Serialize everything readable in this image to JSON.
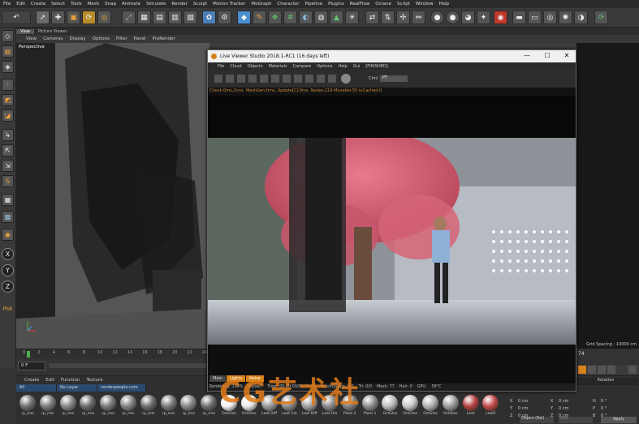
{
  "menubar": [
    "File",
    "Edit",
    "Create",
    "Select",
    "Tools",
    "Mesh",
    "Snap",
    "Animate",
    "Simulate",
    "Render",
    "Sculpt",
    "Motion Tracker",
    "MoGraph",
    "Character",
    "Pipeline",
    "Plugins",
    "RealFlow",
    "Octane",
    "Script",
    "Window",
    "Help"
  ],
  "tabs": [
    "View",
    "Picture Viewer"
  ],
  "viewport_menu": [
    "View",
    "Cameras",
    "Display",
    "Options",
    "Filter",
    "Panel",
    "ProRender"
  ],
  "viewport": {
    "label": "Perspective",
    "grid_spacing": "Grid Spacing : 10000 cm"
  },
  "timeline_ticks": [
    "0",
    "2",
    "4",
    "6",
    "8",
    "10",
    "12",
    "14",
    "16",
    "18",
    "20",
    "22",
    "24"
  ],
  "frame_field": "0 F",
  "frame_end": "74",
  "material_menu": [
    "Create",
    "Edit",
    "Function",
    "Texture"
  ],
  "material_filter": [
    "All",
    "No Layer",
    "renderpeople.com"
  ],
  "materials": [
    {
      "label": "rp_mei",
      "color": "#6e6e6e"
    },
    {
      "label": "rp_mei",
      "color": "#7a7a7a"
    },
    {
      "label": "rp_mei",
      "color": "#858585"
    },
    {
      "label": "rp_mei",
      "color": "#6a6a6a"
    },
    {
      "label": "rp_mei",
      "color": "#777"
    },
    {
      "label": "rp_mei",
      "color": "#808080"
    },
    {
      "label": "rp_mei",
      "color": "#6c6c6c"
    },
    {
      "label": "rp_mei",
      "color": "#787878"
    },
    {
      "label": "rp_mei",
      "color": "#858585"
    },
    {
      "label": "rp_mei",
      "color": "#6d6d6d"
    },
    {
      "label": "OctGlos",
      "color": "#f2f2f2"
    },
    {
      "label": "OctGlos",
      "color": "#e8e8e8"
    },
    {
      "label": "Leaf Diff",
      "color": "#9a9a9a"
    },
    {
      "label": "Leaf Glo",
      "color": "#8a8a8a"
    },
    {
      "label": "Leaf Diff",
      "color": "#a0a0a0"
    },
    {
      "label": "Leaf Glo",
      "color": "#888"
    },
    {
      "label": "Plant 2",
      "color": "#7c7c7c"
    },
    {
      "label": "Plant 1",
      "color": "#8c8c8c"
    },
    {
      "label": "OctGlas",
      "color": "#bcbcbc"
    },
    {
      "label": "OctGlos",
      "color": "#c8c8c8"
    },
    {
      "label": "OctGlos",
      "color": "#b0b0b0"
    },
    {
      "label": "OctGlos",
      "color": "#9c9c9c"
    },
    {
      "label": "Leaf",
      "color": "#b44040"
    },
    {
      "label": "Leaf2",
      "color": "#c24848"
    }
  ],
  "coords": {
    "x": "0 cm",
    "y": "0 cm",
    "z": "0 cm",
    "x2": "0 cm",
    "y2": "0 cm",
    "z2": "0 cm",
    "h": "0 °",
    "p": "0 °",
    "b": "0 °",
    "mode": "Object (Rel)",
    "size": "Size",
    "apply": "Apply",
    "rotation": "Rotation"
  },
  "live_viewer": {
    "title": "Live Viewer Studio 2018.1-RC1 (16 days left)",
    "menu": [
      "File",
      "Cloud",
      "Objects",
      "Materials",
      "Compare",
      "Options",
      "Help",
      "Gui",
      "[FINISHED]"
    ],
    "channel_label": "Chnl",
    "channel_value": "PT",
    "status": "Check:0ms./1ms. MeshGen:0ms. Update[C]:0ms. Nodes:219 Movable:55 txCached:0",
    "tabs": [
      "Main",
      "Lights",
      "Noise"
    ],
    "bottom_status": [
      "Rendering: 100%",
      "Ms/sec:",
      "Time: 00:00:00/00:00:00",
      "Spp/maxspp: 0/0",
      "Tri: 0/0",
      "Mesh: 77",
      "Hair: 0",
      "GPU:",
      "58°C"
    ]
  },
  "watermark": "CG艺术社",
  "colors": {
    "accent_orange": "#d8821a",
    "toolbar_bg": "#3a3a3a"
  }
}
